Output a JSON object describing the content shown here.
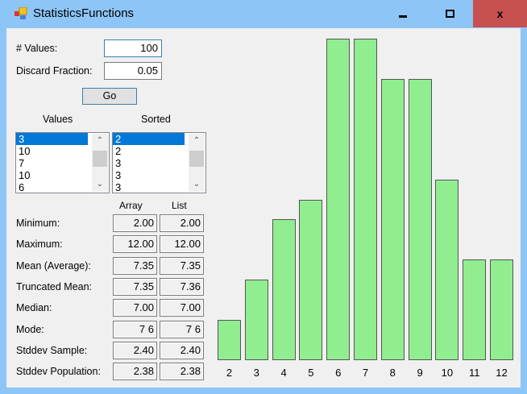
{
  "window": {
    "title": "StatisticsFunctions",
    "minimize": "▁",
    "maximize": "▢",
    "close": "✕"
  },
  "inputs": {
    "num_values_label": "# Values:",
    "num_values": "100",
    "discard_label": "Discard Fraction:",
    "discard": "0.05",
    "go_label": "Go"
  },
  "lists": {
    "values_label": "Values",
    "values": [
      "3",
      "10",
      "7",
      "10",
      "6"
    ],
    "sorted_label": "Sorted",
    "sorted": [
      "2",
      "2",
      "3",
      "3",
      "3"
    ]
  },
  "stats": {
    "array_header": "Array",
    "list_header": "List",
    "rows": [
      {
        "label": "Minimum:",
        "array": "2.00",
        "list": "2.00"
      },
      {
        "label": "Maximum:",
        "array": "12.00",
        "list": "12.00"
      },
      {
        "label": "Mean (Average):",
        "array": "7.35",
        "list": "7.35"
      },
      {
        "label": "Truncated Mean:",
        "array": "7.35",
        "list": "7.36"
      },
      {
        "label": "Median:",
        "array": "7.00",
        "list": "7.00"
      },
      {
        "label": "Mode:",
        "array": "7 6",
        "list": "7 6"
      },
      {
        "label": "Stddev Sample:",
        "array": "2.40",
        "list": "2.40"
      },
      {
        "label": "Stddev Population:",
        "array": "2.38",
        "list": "2.38"
      }
    ]
  },
  "chart_data": {
    "type": "bar",
    "categories": [
      "2",
      "3",
      "4",
      "5",
      "6",
      "7",
      "8",
      "9",
      "10",
      "11",
      "12"
    ],
    "values": [
      2,
      4,
      7,
      8,
      16,
      16,
      14,
      14,
      9,
      5,
      5
    ],
    "ylim": [
      0,
      16
    ],
    "bar_color": "#90ee90"
  }
}
